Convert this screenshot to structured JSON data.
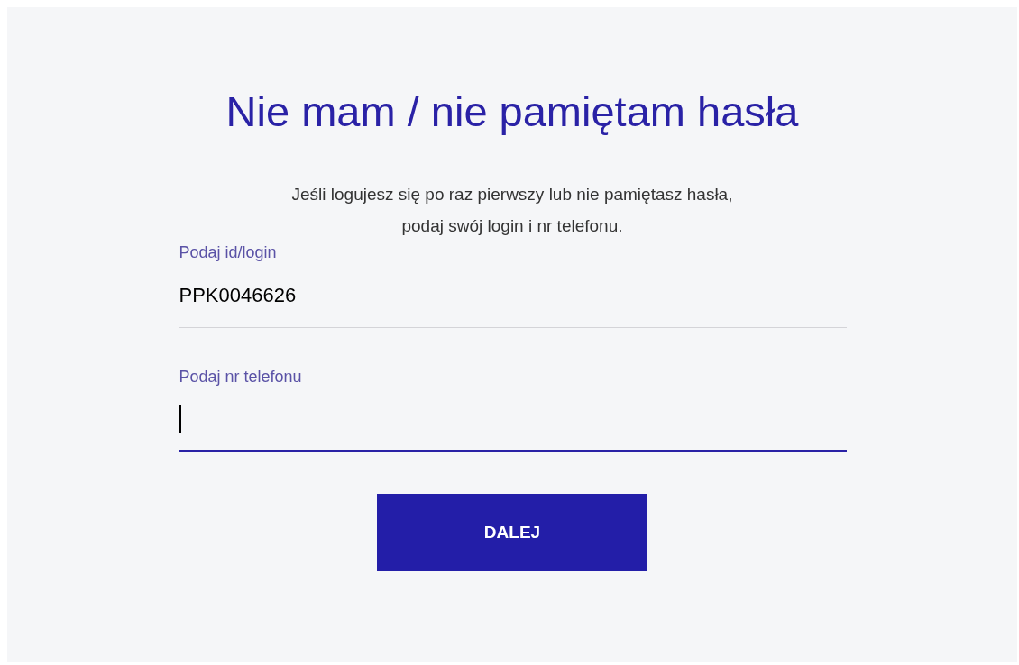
{
  "title": "Nie mam / nie pamiętam hasła",
  "intro": [
    "Jeśli logujesz się po raz pierwszy lub nie pamiętasz hasła,",
    "podaj swój login i nr telefonu."
  ],
  "fields": [
    {
      "label": "Podaj id/login",
      "value": "PPK0046626",
      "focused": false
    },
    {
      "label": "Podaj nr telefonu",
      "focused": true
    }
  ],
  "button": "DALEJ"
}
